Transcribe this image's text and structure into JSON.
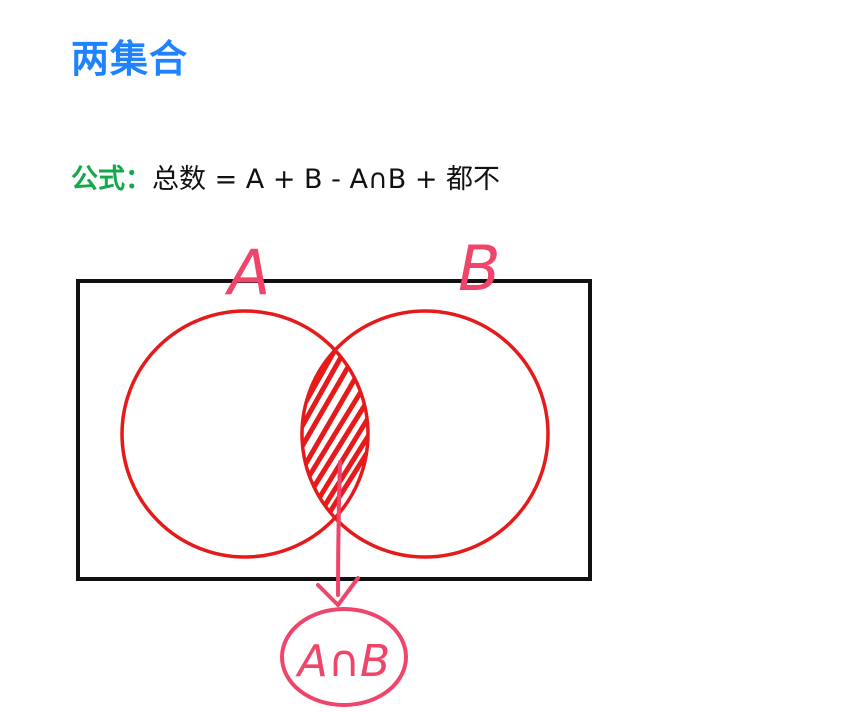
{
  "title": "两集合",
  "formula": {
    "label": "公式：",
    "text": "总数 = A + B - A∩B + 都不"
  },
  "diagram": {
    "set_a_label": "A",
    "set_b_label": "B",
    "intersection_label": "A∩B"
  },
  "colors": {
    "title": "#1f82ff",
    "formula_label": "#14a84b",
    "formula_text": "#111111",
    "circle": "#e51a1a",
    "annotation": "#f0456a",
    "frame": "#111111"
  }
}
